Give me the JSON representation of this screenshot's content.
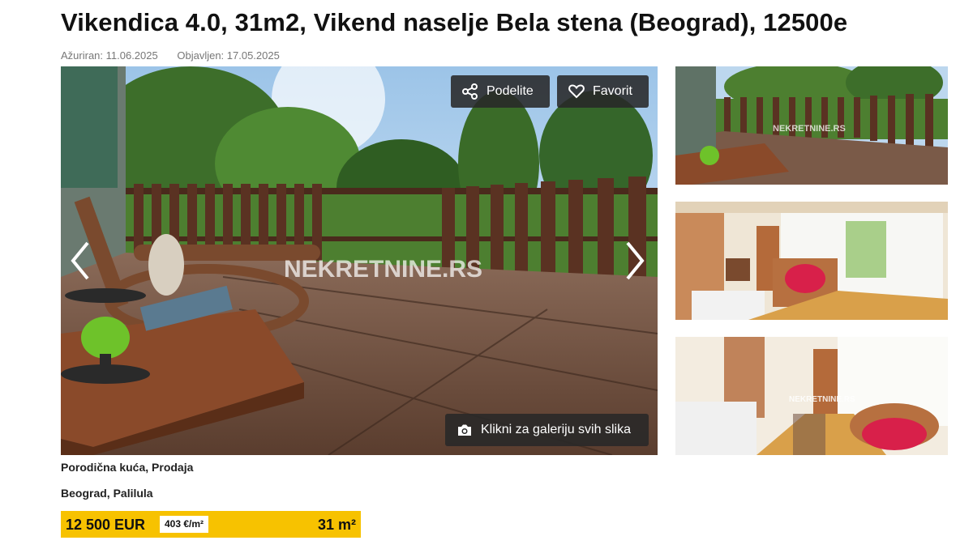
{
  "listing": {
    "title": "Vikendica 4.0, 31m2, Vikend naselje Bela stena (Beograd), 12500e",
    "updated": "Ažuriran: 11.06.2025",
    "published": "Objavljen: 17.05.2025"
  },
  "gallery": {
    "share_label": "Podelite",
    "favorite_label": "Favorit",
    "gallery_label": "Klikni za galeriju svih slika",
    "watermark": "NEKRETNINE.RS",
    "share_icon": "share-icon",
    "favorite_icon": "heart-icon",
    "gallery_icon": "camera-icon"
  },
  "details": {
    "type": "Porodična kuća, Prodaja",
    "location": "Beograd, Palilula"
  },
  "price": {
    "total": "12 500 EUR",
    "per_m2": "403 €/m²",
    "area": "31 m²"
  },
  "colors": {
    "accent_yellow": "#f7c200",
    "button_dark": "#282828"
  }
}
